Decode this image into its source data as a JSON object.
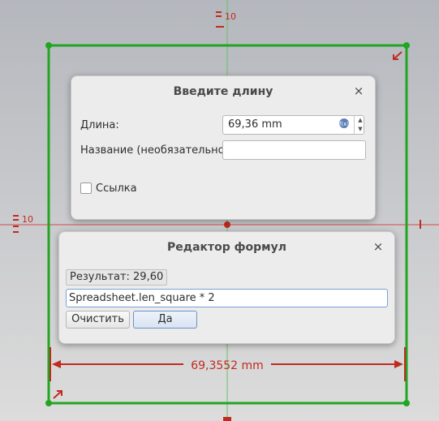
{
  "sketch": {
    "constraint_top": "10",
    "constraint_left": "10",
    "dimension_label": "69,3552 mm"
  },
  "length_dialog": {
    "title": "Введите длину",
    "length_label": "Длина:",
    "length_value": "69,36 mm",
    "name_label": "Название (необязательно)",
    "name_value": "",
    "reference_label": "Ссылка",
    "reference_checked": false
  },
  "formula_dialog": {
    "title": "Редактор формул",
    "result": "Результат: 29,60",
    "expression": "Spreadsheet.len_square * 2",
    "clear_label": "Очистить",
    "ok_label": "Да"
  },
  "colors": {
    "sketch_line": "#22a522",
    "constraint": "#c12a1e",
    "axis": "#d44a4a"
  },
  "icons": {
    "close": "×",
    "expression": "expression-icon"
  }
}
